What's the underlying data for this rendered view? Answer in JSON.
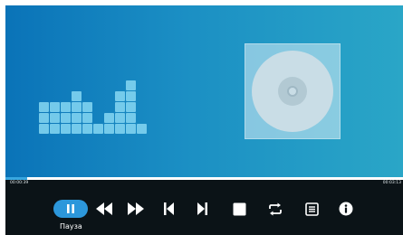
{
  "player": {
    "time_elapsed": "00:00:39",
    "time_total": "00:03:13",
    "progress": 0.2,
    "pause_label": "Пауза",
    "accent_color": "#2c97db",
    "background_gradient": [
      "#0a73b8",
      "#2aa6c7"
    ]
  },
  "equalizer": {
    "column_heights": [
      3,
      3,
      3,
      4,
      3,
      1,
      2,
      4,
      5,
      1
    ]
  },
  "controls": [
    {
      "icon": "pause-icon"
    },
    {
      "icon": "rewind-icon"
    },
    {
      "icon": "fast-forward-icon"
    },
    {
      "icon": "skip-previous-icon"
    },
    {
      "icon": "skip-next-icon"
    },
    {
      "icon": "stop-icon"
    },
    {
      "icon": "repeat-icon"
    },
    {
      "icon": "playlist-icon"
    },
    {
      "icon": "info-icon"
    }
  ]
}
